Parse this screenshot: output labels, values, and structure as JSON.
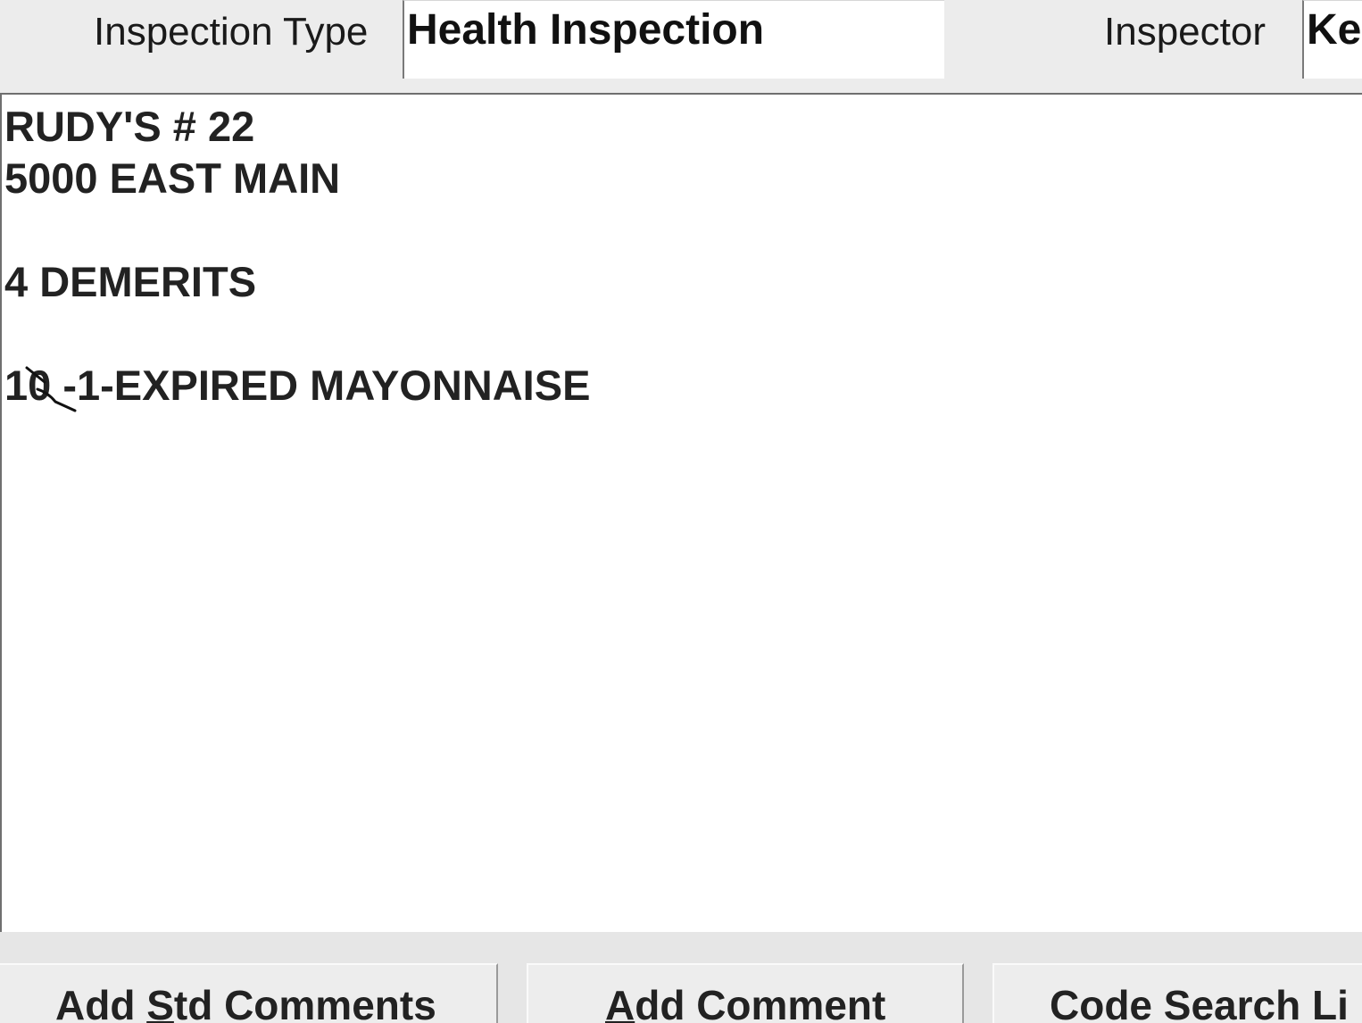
{
  "header": {
    "inspection_type_label": "Inspection Type",
    "inspection_type_value": "Health Inspection",
    "inspector_label": "Inspector",
    "inspector_value": "Ke"
  },
  "notes": {
    "lines": [
      "RUDY'S # 22",
      "5000 EAST MAIN",
      "4 DEMERITS",
      "10 -1-EXPIRED MAYONNAISE"
    ]
  },
  "buttons": {
    "add_std_comments": {
      "pre": "Add ",
      "accel": "S",
      "post": "td Comments"
    },
    "add_comment": {
      "pre": "",
      "accel": "A",
      "post": "dd Comment"
    },
    "code_search": {
      "label": "Code Search Li"
    }
  },
  "colors": {
    "window_bg": "#ececec",
    "field_bg": "#ffffff",
    "text": "#222222"
  }
}
